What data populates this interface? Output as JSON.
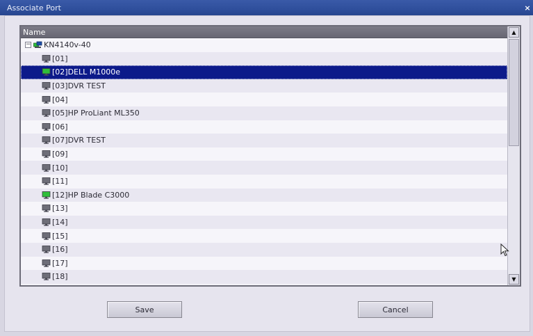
{
  "window": {
    "title": "Associate Port",
    "close_glyph": "×"
  },
  "list": {
    "column_header": "Name",
    "root": {
      "label": "KN4140v-40",
      "expander": "−",
      "icon": "network-device-icon"
    },
    "items": [
      {
        "label": "[01]",
        "icon": "monitor-icon",
        "state": "offline"
      },
      {
        "label": "[02]DELL M1000e",
        "icon": "monitor-icon",
        "state": "online",
        "selected": true
      },
      {
        "label": "[03]DVR TEST",
        "icon": "monitor-icon",
        "state": "offline"
      },
      {
        "label": "[04]",
        "icon": "monitor-icon",
        "state": "offline"
      },
      {
        "label": "[05]HP  ProLiant ML350",
        "icon": "monitor-icon",
        "state": "offline"
      },
      {
        "label": "[06]",
        "icon": "monitor-icon",
        "state": "offline"
      },
      {
        "label": "[07]DVR TEST",
        "icon": "monitor-icon",
        "state": "offline"
      },
      {
        "label": "[09]",
        "icon": "monitor-icon",
        "state": "offline"
      },
      {
        "label": "[10]",
        "icon": "monitor-icon",
        "state": "offline"
      },
      {
        "label": "[11]",
        "icon": "monitor-icon",
        "state": "offline"
      },
      {
        "label": "[12]HP Blade C3000",
        "icon": "monitor-icon",
        "state": "online"
      },
      {
        "label": "[13]",
        "icon": "monitor-icon",
        "state": "offline"
      },
      {
        "label": "[14]",
        "icon": "monitor-icon",
        "state": "offline"
      },
      {
        "label": "[15]",
        "icon": "monitor-icon",
        "state": "offline"
      },
      {
        "label": "[16]",
        "icon": "monitor-icon",
        "state": "offline"
      },
      {
        "label": "[17]",
        "icon": "monitor-icon",
        "state": "offline"
      },
      {
        "label": "[18]",
        "icon": "monitor-icon",
        "state": "offline"
      }
    ]
  },
  "scrollbar": {
    "up_glyph": "▲",
    "down_glyph": "▼"
  },
  "buttons": {
    "save_label": "Save",
    "cancel_label": "Cancel"
  },
  "colors": {
    "selection": "#0c1a8a",
    "online_icon": "#2fbf3a",
    "offline_icon": "#6e6e78",
    "titlebar": "#2f4f9c"
  }
}
